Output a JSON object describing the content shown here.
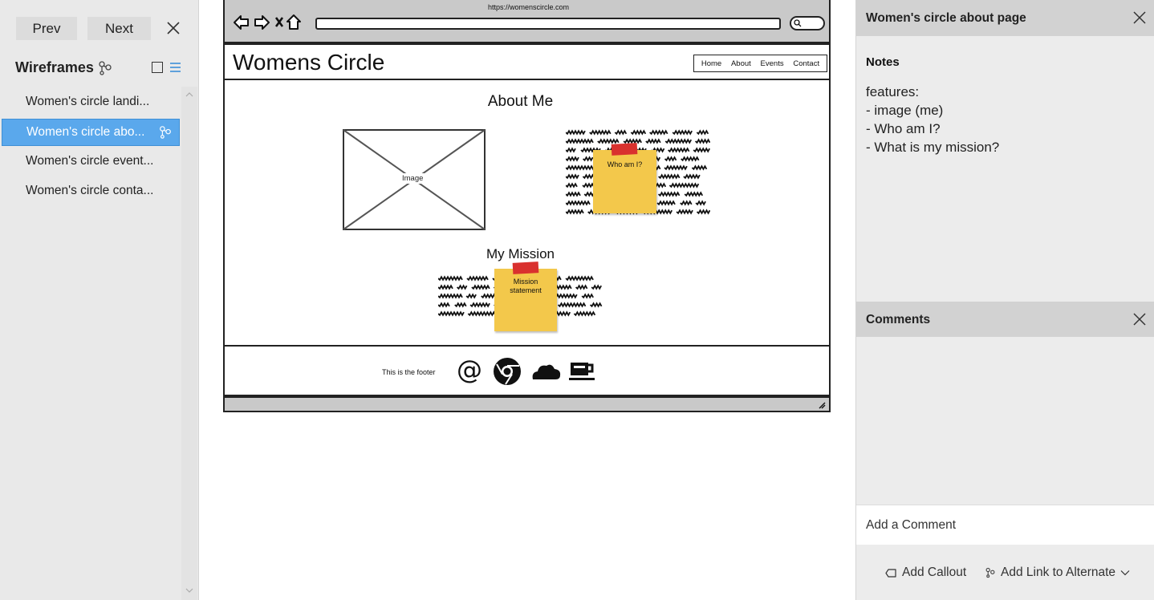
{
  "left_panel": {
    "prev_label": "Prev",
    "next_label": "Next",
    "title": "Wireframes",
    "items": [
      {
        "label": "Women's circle landi..."
      },
      {
        "label": "Women's circle abo..."
      },
      {
        "label": "Women's circle event..."
      },
      {
        "label": "Women's circle conta..."
      }
    ],
    "selected_index": 1
  },
  "wireframe": {
    "url": "https://womenscircle.com",
    "site_title": "Womens Circle",
    "nav": [
      "Home",
      "About",
      "Events",
      "Contact"
    ],
    "about_heading": "About Me",
    "image_label": "Image",
    "who_sticky": "Who am I?",
    "mission_heading": "My Mission",
    "mission_sticky_line1": "Mission",
    "mission_sticky_line2": "statement",
    "footer_text": "This is the footer",
    "footer_icons": [
      "at-icon",
      "chrome-icon",
      "cloud-icon",
      "coffee-icon"
    ],
    "sticky_color": "#f3c84b",
    "tape_color": "#d9312e"
  },
  "right_panel": {
    "title": "Women's circle about page",
    "notes_label": "Notes",
    "notes_lines": [
      "features:",
      "- image (me)",
      "- Who am I?",
      "- What is my mission?"
    ],
    "comments_title": "Comments",
    "comment_placeholder": "Add a Comment",
    "add_callout_label": "Add Callout",
    "add_link_label": "Add Link to Alternate"
  },
  "colors": {
    "selection": "#5aa8ec",
    "panel_bg": "#e9e9e9",
    "header_bg": "#d2d2d2"
  }
}
